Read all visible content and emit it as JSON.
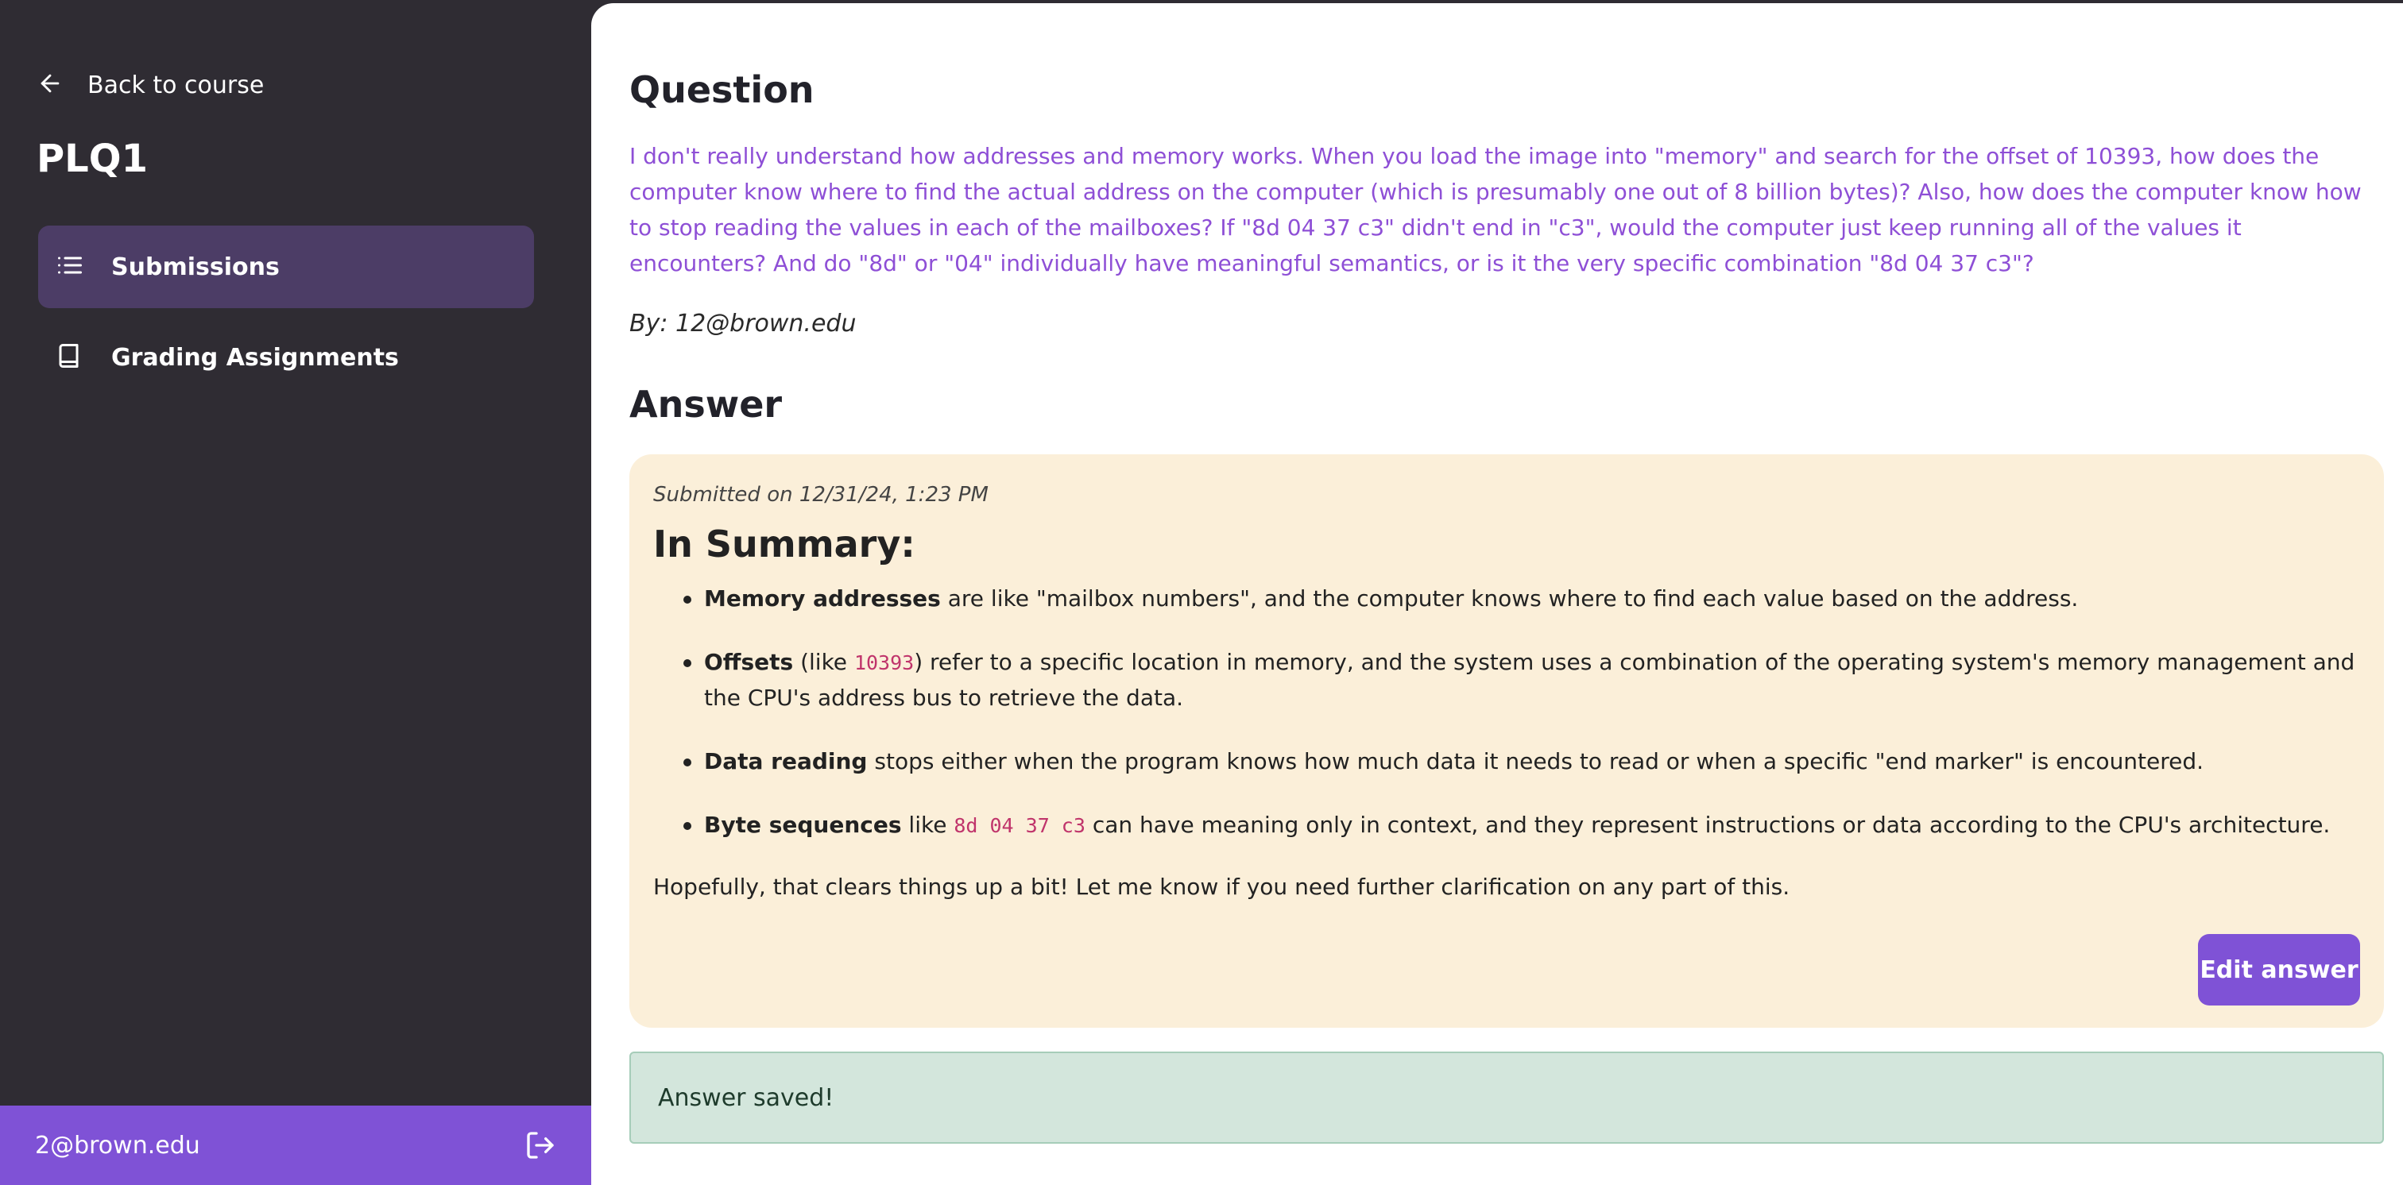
{
  "sidebar": {
    "back_label": "Back to course",
    "course_title": "PLQ1",
    "items": [
      {
        "label": "Submissions",
        "icon": "list-icon",
        "active": true
      },
      {
        "label": "Grading Assignments",
        "icon": "book-icon",
        "active": false
      }
    ],
    "user_email": "2@brown.edu"
  },
  "question": {
    "heading": "Question",
    "text": "I don't really understand how addresses and memory works. When you load the image into \"memory\" and search for the offset of 10393, how does the computer know where to find the actual address on the computer (which is presumably one out of 8 billion bytes)? Also, how does the computer know how to stop reading the values in each of the mailboxes? If \"8d 04 37 c3\" didn't end in \"c3\", would the computer just keep running all of the values it encounters? And do \"8d\" or \"04\" individually have meaningful semantics, or is it the very specific combination \"8d 04 37 c3\"?",
    "byline": "By: 12@brown.edu"
  },
  "answer": {
    "heading": "Answer",
    "submitted": "Submitted on 12/31/24, 1:23 PM",
    "summary_title": "In Summary:",
    "bullets": [
      {
        "term": "Memory addresses",
        "pre": " are like \"mailbox numbers\", and the computer knows where to find each value based on the address.",
        "code": "",
        "post": ""
      },
      {
        "term": "Offsets",
        "pre": " (like ",
        "code": "10393",
        "post": ") refer to a specific location in memory, and the system uses a combination of the operating system's memory management and the CPU's address bus to retrieve the data."
      },
      {
        "term": "Data reading",
        "pre": " stops either when the program knows how much data it needs to read or when a specific \"end marker\" is encountered.",
        "code": "",
        "post": ""
      },
      {
        "term": "Byte sequences",
        "pre": " like ",
        "code": "8d 04 37 c3",
        "post": " can have meaning only in context, and they represent instructions or data according to the CPU's architecture."
      }
    ],
    "closing": "Hopefully, that clears things up a bit! Let me know if you need further clarification on any part of this.",
    "edit_label": "Edit answer"
  },
  "banner": {
    "message": "Answer saved!"
  },
  "colors": {
    "sidebar_bg": "#2f2c33",
    "accent": "#7f52d6",
    "active_nav": "#4c3d66",
    "question_text": "#8e4fd6",
    "answer_card": "#fbefd9",
    "success_bg": "#d3e6dc"
  }
}
